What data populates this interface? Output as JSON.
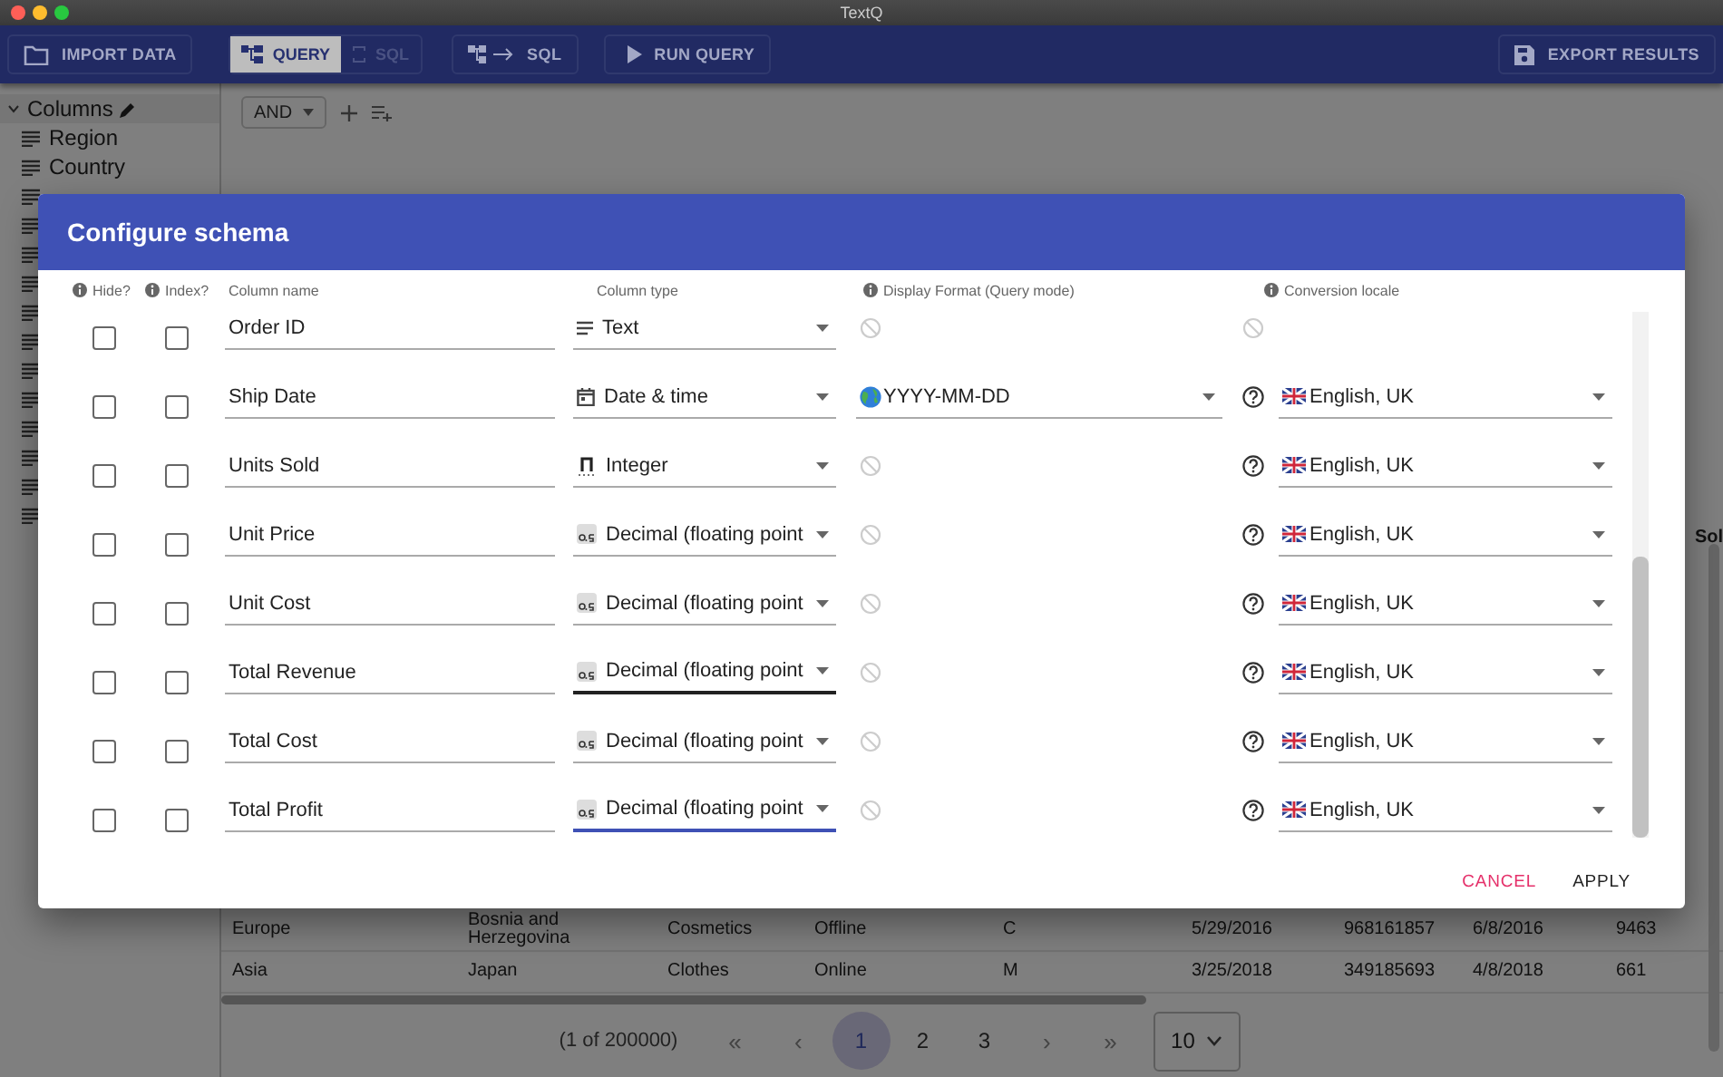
{
  "window": {
    "title": "TextQ"
  },
  "toolbar": {
    "import_button": "IMPORT DATA",
    "mode_toggle": [
      {
        "label": "QUERY",
        "selected": true
      },
      {
        "label": "SQL",
        "selected": false
      }
    ],
    "convert_button": "SQL",
    "run_button": "RUN QUERY",
    "export_button": "EXPORT RESULTS"
  },
  "sidebar": {
    "header": "Columns",
    "expanded": true,
    "items": [
      {
        "kind": "text",
        "label": "Region"
      },
      {
        "kind": "text",
        "label": "Country"
      },
      {
        "kind": "text"
      },
      {
        "kind": "text"
      },
      {
        "kind": "text"
      },
      {
        "kind": "text"
      },
      {
        "kind": "text"
      },
      {
        "kind": "text"
      },
      {
        "kind": "text"
      },
      {
        "kind": "text"
      },
      {
        "kind": "text"
      },
      {
        "kind": "text"
      },
      {
        "kind": "text"
      },
      {
        "kind": "text"
      }
    ]
  },
  "filter": {
    "operator": "AND"
  },
  "table": {
    "header_fragment": "Sol",
    "rows": [
      [
        "Europe",
        "Bosnia and Herzegovina",
        "Cosmetics",
        "Offline",
        "C",
        "5/29/2016",
        "968161857",
        "6/8/2016",
        "9463"
      ],
      [
        "Asia",
        "Japan",
        "Clothes",
        "Online",
        "M",
        "3/25/2018",
        "349185693",
        "4/8/2018",
        "661"
      ]
    ]
  },
  "pagination": {
    "summary": "(1 of 200000)",
    "first": "«",
    "previous": "‹",
    "pages": [
      {
        "label": "1",
        "selected": true
      },
      {
        "label": "2",
        "selected": false
      },
      {
        "label": "3",
        "selected": false
      }
    ],
    "next": "›",
    "last": "»",
    "page_size": "10"
  },
  "dialog": {
    "title": "Configure schema",
    "columns": [
      {
        "label": "Hide?",
        "info": true
      },
      {
        "label": "Index?",
        "info": true
      },
      {
        "label": "Column name",
        "info": false
      },
      {
        "label": "Column type",
        "info": false
      },
      {
        "label": "Display Format (Query mode)",
        "info": true
      },
      {
        "label": "Conversion locale",
        "info": true
      }
    ],
    "rows": [
      {
        "hide": false,
        "index": false,
        "name": "Order ID",
        "type": {
          "kind": "text",
          "label": "Text",
          "hovered": false,
          "focused": false
        }
      },
      {
        "hide": false,
        "index": false,
        "name": "Ship Date",
        "type": {
          "kind": "date",
          "label": "Date & time",
          "hovered": false,
          "focused": false
        },
        "format": "YYYY-MM-DD",
        "locale": "English, UK"
      },
      {
        "hide": false,
        "index": false,
        "name": "Units Sold",
        "type": {
          "kind": "integer",
          "label": "Integer",
          "hovered": false,
          "focused": false
        },
        "locale": "English, UK"
      },
      {
        "hide": false,
        "index": false,
        "name": "Unit Price",
        "type": {
          "kind": "decimal",
          "label": "Decimal (floating point",
          "hovered": false,
          "focused": false
        },
        "locale": "English, UK"
      },
      {
        "hide": false,
        "index": false,
        "name": "Unit Cost",
        "type": {
          "kind": "decimal",
          "label": "Decimal (floating point",
          "hovered": false,
          "focused": false
        },
        "locale": "English, UK"
      },
      {
        "hide": false,
        "index": false,
        "name": "Total Revenue",
        "type": {
          "kind": "decimal",
          "label": "Decimal (floating point",
          "hovered": true,
          "focused": false
        },
        "locale": "English, UK"
      },
      {
        "hide": false,
        "index": false,
        "name": "Total Cost",
        "type": {
          "kind": "decimal",
          "label": "Decimal (floating point",
          "hovered": false,
          "focused": false
        },
        "locale": "English, UK"
      },
      {
        "hide": false,
        "index": false,
        "name": "Total Profit",
        "type": {
          "kind": "decimal",
          "label": "Decimal (floating point",
          "hovered": false,
          "focused": true
        },
        "locale": "English, UK"
      }
    ],
    "buttons": [
      {
        "label": "CANCEL",
        "kind": "secondary"
      },
      {
        "label": "APPLY",
        "kind": "primary"
      }
    ]
  }
}
